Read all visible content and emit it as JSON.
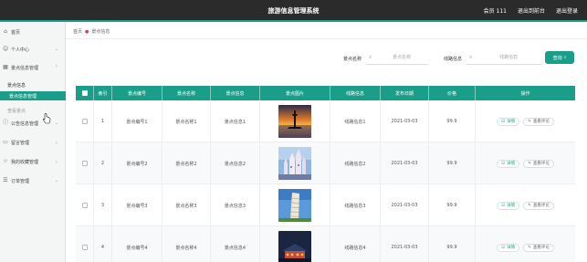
{
  "header": {
    "title": "旅游信息管理系统",
    "user": "会员 111",
    "back_link": "退出到前台",
    "logout_link": "退出登录"
  },
  "sidebar": {
    "items": [
      {
        "label": "首页",
        "icon": "home-icon"
      },
      {
        "label": "个人中心",
        "icon": "user-icon"
      },
      {
        "label": "景点信息管理",
        "icon": "grid-icon"
      },
      {
        "label": "公告信息管理",
        "icon": "info-icon"
      },
      {
        "label": "留言管理",
        "icon": "message-icon"
      },
      {
        "label": "我的收藏管理",
        "icon": "star-icon"
      },
      {
        "label": "订单管理",
        "icon": "list-icon"
      }
    ],
    "sub_items": [
      "景点信息",
      "景点信息管理",
      "查看景点"
    ]
  },
  "breadcrumb": {
    "home": "首页",
    "current": "景点信息"
  },
  "search": {
    "field1_label": "景点名称",
    "field1_placeholder": "景点名称",
    "field2_label": "线路信息",
    "field2_placeholder": "线路信息",
    "button_label": "查询"
  },
  "table": {
    "columns": [
      "",
      "索引",
      "景点编号",
      "景点名称",
      "景点信息",
      "景点图片",
      "线路信息",
      "发布日期",
      "价格",
      "操作"
    ],
    "rows": [
      {
        "index": "1",
        "code": "景点编号1",
        "name": "景点名称1",
        "info": "景点信息1",
        "image": "sunset-pier-image",
        "route": "线路信息1",
        "date": "2021-03-03",
        "price": "99.9"
      },
      {
        "index": "2",
        "code": "景点编号2",
        "name": "景点名称2",
        "info": "景点信息2",
        "image": "castle-image",
        "route": "线路信息2",
        "date": "2021-03-03",
        "price": "99.9"
      },
      {
        "index": "3",
        "code": "景点编号3",
        "name": "景点名称3",
        "info": "景点信息3",
        "image": "leaning-tower-image",
        "route": "线路信息3",
        "date": "2021-03-03",
        "price": "99.9"
      },
      {
        "index": "4",
        "code": "景点编号4",
        "name": "景点名称4",
        "info": "景点信息4",
        "image": "night-temple-image",
        "route": "线路信息4",
        "date": "2021-03-03",
        "price": "99.9"
      }
    ],
    "actions": {
      "detail": "详情",
      "comment": "查看评论"
    }
  },
  "colors": {
    "accent": "#1a9e8a",
    "topbar": "#2b2b2b"
  }
}
